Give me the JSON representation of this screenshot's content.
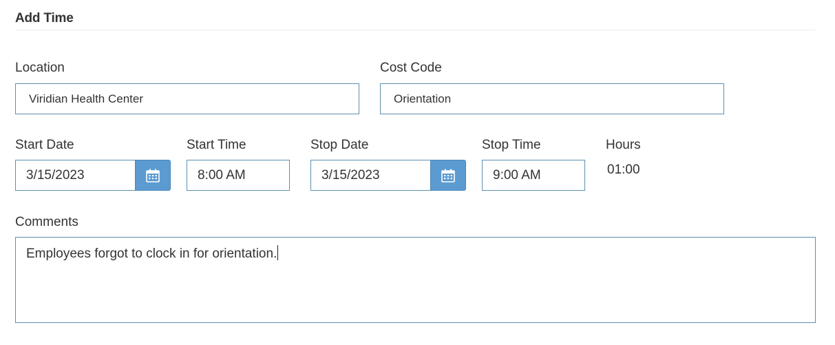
{
  "section": {
    "title": "Add Time"
  },
  "location": {
    "label": "Location",
    "value": "Viridian Health Center"
  },
  "cost_code": {
    "label": "Cost Code",
    "value": "Orientation"
  },
  "start_date": {
    "label": "Start Date",
    "value": "3/15/2023",
    "button_icon": "calendar-icon"
  },
  "start_time": {
    "label": "Start Time",
    "value": "8:00 AM"
  },
  "stop_date": {
    "label": "Stop Date",
    "value": "3/15/2023",
    "button_icon": "calendar-icon"
  },
  "stop_time": {
    "label": "Stop Time",
    "value": "9:00 AM"
  },
  "hours": {
    "label": "Hours",
    "value": "01:00"
  },
  "comments": {
    "label": "Comments",
    "value": "Employees forgot to clock in for orientation."
  },
  "colors": {
    "field_border": "#5b8fb0",
    "button_bg": "#5b9bd1",
    "text": "#333333"
  }
}
